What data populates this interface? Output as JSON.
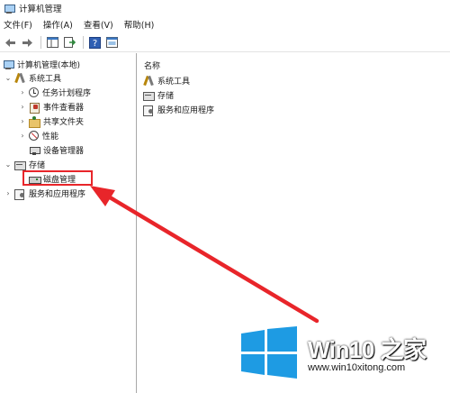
{
  "window": {
    "title": "计算机管理"
  },
  "menu": [
    "文件(F)",
    "操作(A)",
    "查看(V)",
    "帮助(H)"
  ],
  "toolbar": {
    "buttons": [
      "back-icon",
      "forward-icon",
      "show-hide-tree-icon",
      "export-list-icon",
      "help-icon",
      "properties-icon"
    ]
  },
  "tree": {
    "root": "计算机管理(本地)",
    "system_tools": "系统工具",
    "task_scheduler": "任务计划程序",
    "event_viewer": "事件查看器",
    "shared_folders": "共享文件夹",
    "performance": "性能",
    "device_manager": "设备管理器",
    "storage": "存储",
    "disk_management": "磁盘管理",
    "services_apps": "服务和应用程序"
  },
  "right": {
    "column_header": "名称",
    "items": [
      "系统工具",
      "存储",
      "服务和应用程序"
    ]
  },
  "watermark": {
    "brand": "Win10 之家",
    "url": "www.win10xitong.com"
  },
  "colors": {
    "annotation_red": "#e8252a",
    "logo_blue": "#1e9be3"
  }
}
